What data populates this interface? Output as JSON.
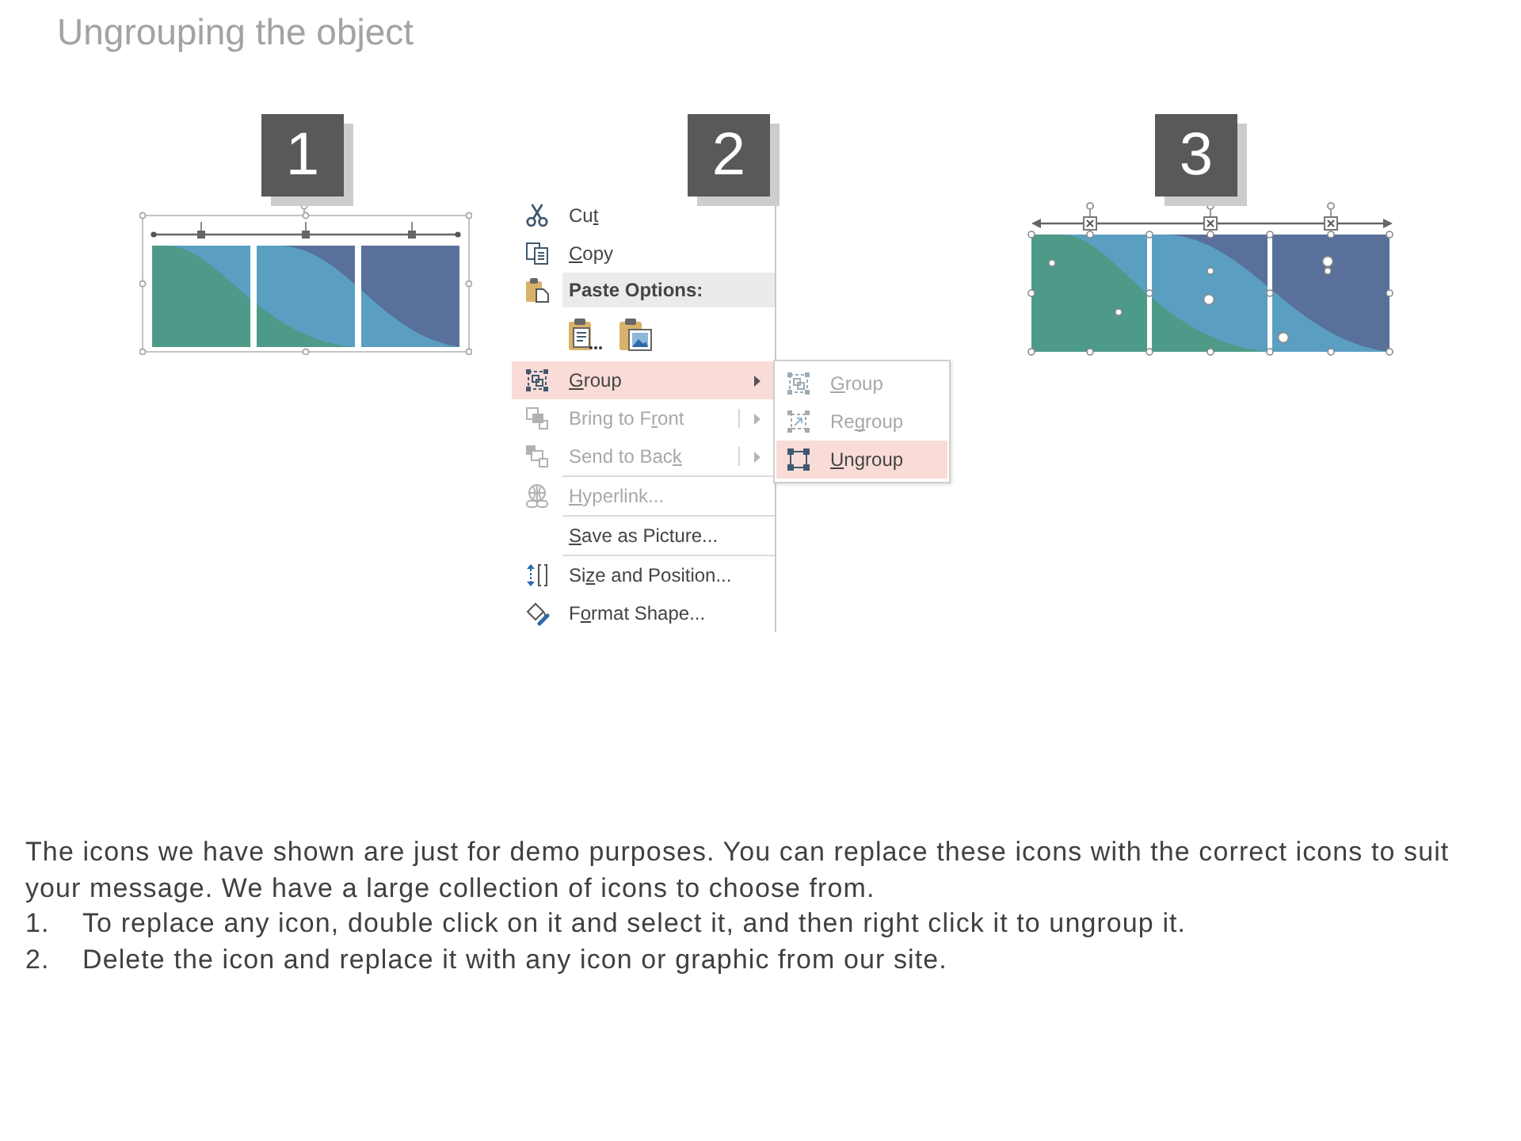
{
  "title": "Ungrouping the object",
  "steps": [
    {
      "number": "1",
      "kind": "graphic",
      "ungrouped": false
    },
    {
      "number": "2",
      "kind": "menu",
      "menu": {
        "items": [
          {
            "kind": "item",
            "label": [
              {
                "text": "Cu",
                "underline": false
              },
              {
                "text": "t",
                "underline": true
              }
            ],
            "disabled": false,
            "selected": false,
            "arrow": false,
            "split": false
          },
          {
            "kind": "item",
            "label": [
              {
                "text": "C",
                "underline": true
              },
              {
                "text": "opy",
                "underline": false
              }
            ],
            "disabled": false,
            "selected": false,
            "arrow": false,
            "split": false
          },
          {
            "kind": "header",
            "label": [
              {
                "text": "Paste Options:",
                "underline": false
              }
            ]
          },
          {
            "kind": "paste-icons"
          },
          {
            "kind": "item",
            "label": [
              {
                "text": "G",
                "underline": true
              },
              {
                "text": "roup",
                "underline": false
              }
            ],
            "disabled": false,
            "selected": true,
            "arrow": true,
            "split": false,
            "submenu": {
              "items": [
                {
                  "label": [
                    {
                      "text": "G",
                      "underline": true
                    },
                    {
                      "text": "roup",
                      "underline": false
                    }
                  ],
                  "disabled": true,
                  "selected": false
                },
                {
                  "label": [
                    {
                      "text": "Re",
                      "underline": false
                    },
                    {
                      "text": "g",
                      "underline": true
                    },
                    {
                      "text": "roup",
                      "underline": false
                    }
                  ],
                  "disabled": true,
                  "selected": false
                },
                {
                  "label": [
                    {
                      "text": "U",
                      "underline": true
                    },
                    {
                      "text": "ngroup",
                      "underline": false
                    }
                  ],
                  "disabled": false,
                  "selected": true
                }
              ]
            }
          },
          {
            "kind": "item",
            "label": [
              {
                "text": "Bring to F",
                "underline": false
              },
              {
                "text": "r",
                "underline": true
              },
              {
                "text": "ont",
                "underline": false
              }
            ],
            "disabled": true,
            "selected": false,
            "arrow": true,
            "split": true
          },
          {
            "kind": "item",
            "label": [
              {
                "text": "Send to Bac",
                "underline": false
              },
              {
                "text": "k",
                "underline": true
              }
            ],
            "disabled": true,
            "selected": false,
            "arrow": true,
            "split": true
          },
          {
            "kind": "separator"
          },
          {
            "kind": "item",
            "label": [
              {
                "text": "H",
                "underline": true
              },
              {
                "text": "yperlink...",
                "underline": false
              }
            ],
            "disabled": true,
            "selected": false,
            "arrow": false,
            "split": false
          },
          {
            "kind": "separator"
          },
          {
            "kind": "item",
            "label": [
              {
                "text": "S",
                "underline": true
              },
              {
                "text": "ave as Picture...",
                "underline": false
              }
            ],
            "disabled": false,
            "selected": false,
            "arrow": false,
            "split": false
          },
          {
            "kind": "separator"
          },
          {
            "kind": "item",
            "label": [
              {
                "text": "Si",
                "underline": false
              },
              {
                "text": "z",
                "underline": true
              },
              {
                "text": "e and Position...",
                "underline": false
              }
            ],
            "disabled": false,
            "selected": false,
            "arrow": false,
            "split": false
          },
          {
            "kind": "item",
            "label": [
              {
                "text": "F",
                "underline": false
              },
              {
                "text": "o",
                "underline": true
              },
              {
                "text": "rmat Shape...",
                "underline": false
              }
            ],
            "disabled": false,
            "selected": false,
            "arrow": false,
            "split": false
          }
        ]
      }
    },
    {
      "number": "3",
      "kind": "graphic",
      "ungrouped": true
    }
  ],
  "note": {
    "paragraph": "The icons we have shown are just for demo purposes. You can replace these icons with the correct icons to suit your message. We have a large collection of icons to choose from.",
    "items": [
      {
        "number": "1.",
        "text": "To replace any icon, double click on it and select it, and then right click it to ungroup it."
      },
      {
        "number": "2.",
        "text": "Delete the icon and replace it with any icon or graphic from our site."
      }
    ]
  }
}
